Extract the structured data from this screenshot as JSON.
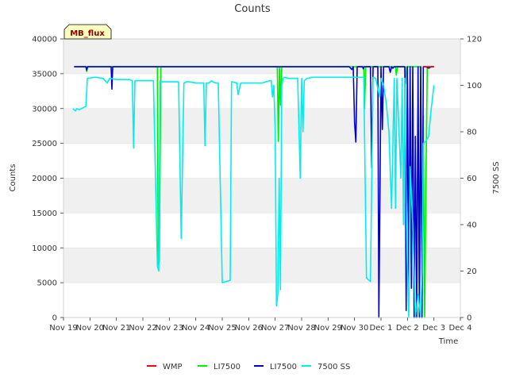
{
  "chart_data": {
    "type": "line",
    "title": "Counts",
    "xlabel": "Time",
    "ylabel": "Counts",
    "y2label": "7500 SS",
    "badge": "MB_flux",
    "xlim": [
      0,
      15
    ],
    "ylim": [
      0,
      40000
    ],
    "y2lim": [
      0,
      120
    ],
    "x_ticks": [
      0,
      1,
      2,
      3,
      4,
      5,
      6,
      7,
      8,
      9,
      10,
      11,
      12,
      13,
      14,
      15
    ],
    "x_tick_labels": [
      "Nov 19",
      "Nov 20",
      "Nov 21",
      "Nov 22",
      "Nov 23",
      "Nov 24",
      "Nov 25",
      "Nov 26",
      "Nov 27",
      "Nov 28",
      "Nov 29",
      "Nov 30",
      "Dec 1",
      "Dec 2",
      "Dec 3",
      "Dec 4"
    ],
    "y_ticks": [
      0,
      5000,
      10000,
      15000,
      20000,
      25000,
      30000,
      35000,
      40000
    ],
    "y2_ticks": [
      0,
      20,
      40,
      60,
      80,
      100,
      120
    ],
    "grid": "horizontal bands",
    "legend_position": "bottom",
    "series": [
      {
        "name": "WMP",
        "color": "#ff0000",
        "axis": "left",
        "x": [
          13.6,
          14.0
        ],
        "y": [
          36000,
          36000
        ]
      },
      {
        "name": "LI7500",
        "color": "#00ee00",
        "axis": "left",
        "x": [
          0.4,
          0.85,
          0.88,
          0.91,
          3.55,
          3.58,
          3.62,
          3.68,
          8.08,
          8.12,
          8.16,
          8.2,
          8.25,
          8.3,
          11.35,
          11.38,
          11.42,
          12.55,
          12.58,
          12.62,
          12.9,
          12.93,
          12.97,
          13.5,
          13.55,
          13.6,
          13.65,
          13.7,
          13.75,
          14.0
        ],
        "y": [
          36000,
          36000,
          35300,
          36000,
          36000,
          7600,
          8000,
          36000,
          36000,
          25300,
          36000,
          30500,
          36000,
          36000,
          36000,
          30000,
          36000,
          36000,
          34800,
          36000,
          36000,
          33500,
          36000,
          36000,
          0,
          29000,
          0,
          20000,
          36000,
          36000
        ]
      },
      {
        "name": "LI7500",
        "color": "#0000cc",
        "axis": "left",
        "x": [
          0.4,
          0.85,
          0.88,
          0.91,
          1.8,
          1.83,
          1.86,
          10.8,
          10.9,
          10.95,
          11.0,
          11.05,
          11.1,
          11.3,
          11.33,
          11.36,
          11.6,
          11.65,
          11.7,
          11.88,
          11.92,
          11.96,
          12.0,
          12.05,
          12.1,
          12.3,
          12.35,
          12.4,
          12.45,
          12.5,
          12.55,
          12.6,
          12.9,
          12.95,
          13.0,
          13.05,
          13.1,
          13.15,
          13.2,
          13.25,
          13.3,
          13.35,
          13.4,
          13.45,
          13.5,
          13.55,
          13.6,
          13.7,
          13.8,
          13.9,
          14.0
        ],
        "y": [
          36000,
          36000,
          35500,
          36000,
          36000,
          32800,
          36000,
          36000,
          35600,
          36000,
          28000,
          25200,
          36000,
          36000,
          35700,
          36000,
          36000,
          21500,
          36000,
          36000,
          0,
          18000,
          36000,
          27000,
          36000,
          36000,
          35200,
          36000,
          35800,
          36000,
          36000,
          36000,
          36000,
          1000,
          36000,
          4500,
          36000,
          4200,
          36000,
          0,
          26000,
          0,
          36000,
          0,
          36000,
          0,
          36000,
          36000,
          35800,
          36000,
          36000
        ]
      },
      {
        "name": "7500 SS",
        "color": "#00eeee",
        "axis": "right",
        "x": [
          0.35,
          0.45,
          0.5,
          0.6,
          0.85,
          0.9,
          1.2,
          1.5,
          1.65,
          1.75,
          2.0,
          2.5,
          2.6,
          2.65,
          2.7,
          3.0,
          3.4,
          3.55,
          3.6,
          3.65,
          3.7,
          4.0,
          4.35,
          4.45,
          4.55,
          4.65,
          4.75,
          5.0,
          5.3,
          5.35,
          5.4,
          5.5,
          5.6,
          5.65,
          5.75,
          5.85,
          6.0,
          6.3,
          6.35,
          6.4,
          6.55,
          6.6,
          6.7,
          7.0,
          7.5,
          7.8,
          7.85,
          7.9,
          7.95,
          8.0,
          8.05,
          8.1,
          8.15,
          8.2,
          8.25,
          8.3,
          8.35,
          8.5,
          8.85,
          8.95,
          9.0,
          9.05,
          9.1,
          9.2,
          9.25,
          9.4,
          9.6,
          10.0,
          10.5,
          10.8,
          11.0,
          11.2,
          11.35,
          11.45,
          11.6,
          11.7,
          11.8,
          11.95,
          12.0,
          12.1,
          12.2,
          12.3,
          12.4,
          12.5,
          12.55,
          12.6,
          12.7,
          12.75,
          12.8,
          12.85,
          12.9,
          12.95,
          13.0,
          13.05,
          13.1,
          13.2,
          13.3,
          13.4,
          13.5,
          13.55,
          13.6,
          13.7,
          13.8,
          13.9,
          14.0
        ],
        "y": [
          90,
          89,
          90,
          89.5,
          91,
          103,
          103.5,
          103,
          101,
          103,
          102.5,
          102.5,
          102,
          73,
          102,
          102,
          102,
          22,
          20,
          102,
          101.5,
          101.5,
          101.5,
          34,
          101,
          101.5,
          101.5,
          101,
          101,
          74,
          101,
          101,
          102,
          101.5,
          101,
          101,
          15,
          16,
          101.5,
          101.5,
          101,
          96,
          101,
          101,
          101,
          102,
          102,
          95,
          100,
          80,
          5,
          10,
          60,
          12,
          100,
          103,
          103.5,
          103,
          103,
          60,
          103,
          80,
          102,
          103,
          103,
          103.5,
          103.5,
          103.5,
          103.5,
          103.5,
          103.5,
          103.5,
          103.5,
          17,
          15.5,
          103.5,
          103,
          95,
          103,
          100,
          92,
          80,
          47,
          103,
          47,
          103,
          75,
          60,
          103,
          40,
          103,
          50,
          20,
          0,
          65,
          40,
          0,
          10,
          0,
          20,
          75,
          76,
          78,
          90,
          100
        ]
      }
    ]
  }
}
